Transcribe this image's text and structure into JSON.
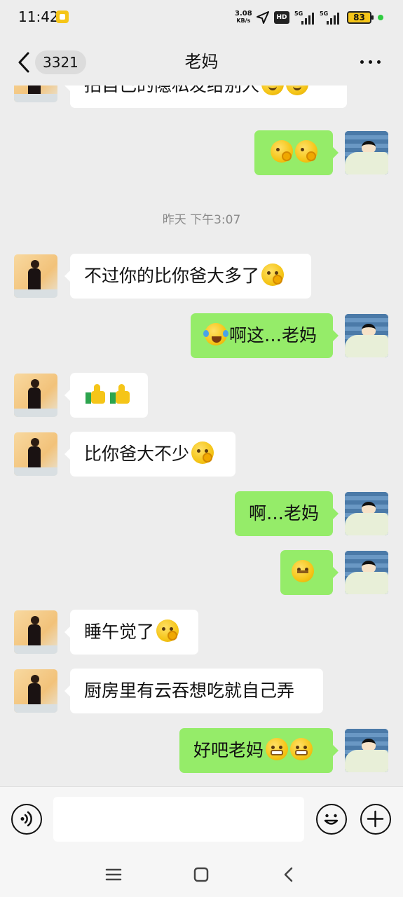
{
  "status_bar": {
    "time": "11:42",
    "net_speed_value": "3.08",
    "net_speed_unit": "KB/s",
    "hd_label": "HD",
    "signal_1_label": "5G",
    "signal_2_label": "5G",
    "battery": "83",
    "app_icon": "notification-app-icon",
    "battery_color": "#f5c518"
  },
  "header": {
    "back_icon": "chevron-left-icon",
    "unread_count": "3321",
    "title": "老妈",
    "more_icon": "more-dots-icon"
  },
  "messages": [
    {
      "side": "in",
      "text": "拍自己的隐私发给别人",
      "emoji": [
        "tired-face",
        "tired-face"
      ]
    },
    {
      "side": "out",
      "text": "",
      "emoji": [
        "winking-face",
        "winking-face"
      ]
    },
    {
      "type": "time",
      "text": "昨天 下午3:07"
    },
    {
      "side": "in",
      "text": "不过你的比你爸大多了",
      "emoji": [
        "smirk-hand-face"
      ]
    },
    {
      "side": "out",
      "text": "啊这…老妈",
      "emoji": [
        "laughing-tears-face"
      ],
      "emoji_first": true
    },
    {
      "side": "in",
      "text": "",
      "emoji": [
        "thumbs-up",
        "thumbs-up"
      ]
    },
    {
      "side": "in",
      "text": "比你爸大不少",
      "emoji": [
        "smirk-hand-face"
      ]
    },
    {
      "side": "out",
      "text": "啊…老妈",
      "emoji": []
    },
    {
      "side": "out",
      "text": "",
      "emoji": [
        "zipper-mouth-face"
      ]
    },
    {
      "side": "in",
      "text": "睡午觉了",
      "emoji": [
        "smirk-hand-face"
      ]
    },
    {
      "side": "in",
      "text": "厨房里有云吞想吃就自己弄",
      "emoji": []
    },
    {
      "side": "out",
      "text": "好吧老妈",
      "emoji": [
        "grimacing-face",
        "grimacing-face"
      ]
    }
  ],
  "input_bar": {
    "voice_icon": "voice-icon",
    "placeholder": "",
    "emoji_icon": "emoji-icon",
    "plus_icon": "plus-icon"
  },
  "system_nav": {
    "menu_icon": "menu-icon",
    "home_icon": "home-icon",
    "back_icon": "back-icon"
  },
  "colors": {
    "background": "#ededed",
    "incoming_bubble": "#ffffff",
    "outgoing_bubble": "#95ec69",
    "timestamp": "#8a8a8a"
  }
}
